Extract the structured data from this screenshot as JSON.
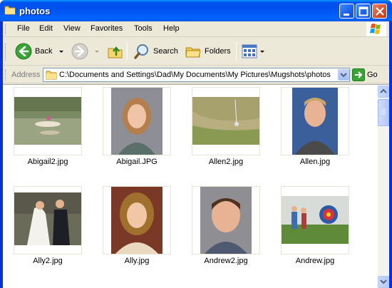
{
  "window": {
    "title": "photos",
    "accent": "#0054e3"
  },
  "menu": {
    "items": [
      {
        "label": "File"
      },
      {
        "label": "Edit"
      },
      {
        "label": "View"
      },
      {
        "label": "Favorites"
      },
      {
        "label": "Tools"
      },
      {
        "label": "Help"
      }
    ]
  },
  "toolbar": {
    "back_label": "Back",
    "search_label": "Search",
    "folders_label": "Folders"
  },
  "address": {
    "label": "Address",
    "value": "C:\\Documents and Settings\\Dad\\My Documents\\My Pictures\\Mugshots\\photos",
    "go_label": "Go"
  },
  "files": [
    {
      "name": "Abigail2.jpg"
    },
    {
      "name": "Abigail.JPG"
    },
    {
      "name": "Allen2.jpg"
    },
    {
      "name": "Allen.jpg"
    },
    {
      "name": "Ally2.jpg"
    },
    {
      "name": "Ally.jpg"
    },
    {
      "name": "Andrew2.jpg"
    },
    {
      "name": "Andrew.jpg"
    }
  ]
}
